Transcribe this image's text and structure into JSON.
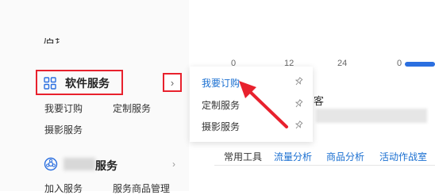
{
  "sidebar": {
    "top_fragment": "店铺",
    "section1": {
      "title": "软件服务",
      "links": [
        "我要订购",
        "定制服务",
        "摄影服务"
      ]
    },
    "section2": {
      "title": "服务",
      "links": [
        "加入服务",
        "服务商品管理"
      ]
    }
  },
  "popup": {
    "items": [
      {
        "label": "我要订购",
        "active": true
      },
      {
        "label": "定制服务",
        "active": false
      },
      {
        "label": "摄影服务",
        "active": false
      }
    ]
  },
  "chart_axis": [
    "0",
    "12",
    "24",
    "0"
  ],
  "right_fragment": "客",
  "tabs": [
    "常用工具",
    "流量分析",
    "商品分析",
    "活动作战室"
  ],
  "colors": {
    "highlight_border": "#e8212d",
    "arrow": "#e8212d",
    "link_blue": "#1a6fd1",
    "icon_blue": "#2b6fe0"
  },
  "icons": {
    "section1_icon": "grid-icon",
    "section2_icon": "flower-icon",
    "expand": "chevron-right-icon",
    "pin": "pin-icon"
  }
}
